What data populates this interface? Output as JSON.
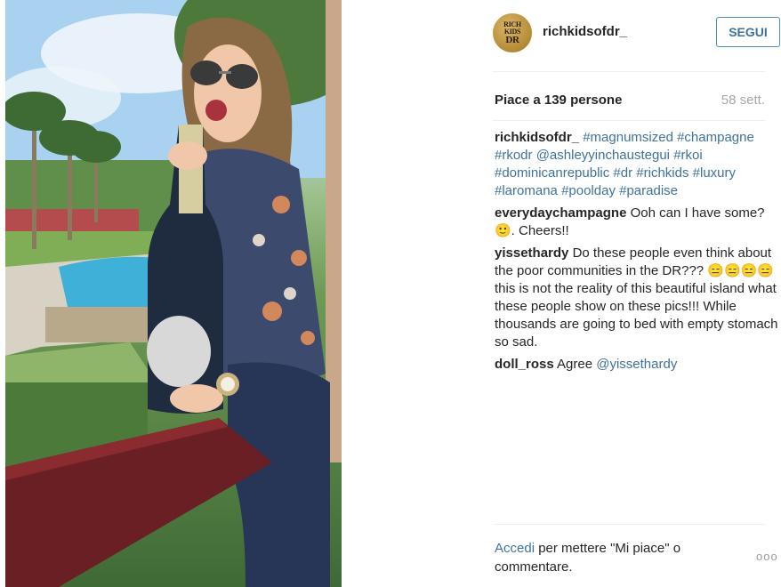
{
  "profile": {
    "username": "richkidsofdr_",
    "avatar_lines": [
      "RICH",
      "KIDS",
      "DR"
    ],
    "follow_label": "SEGUI"
  },
  "stats": {
    "likes_text": "Piace a 139 persone",
    "time_text": "58 sett."
  },
  "comments": [
    {
      "user": "richkidsofdr_",
      "parts": [
        {
          "text": "#magnumsized",
          "tag": true
        },
        {
          "text": " ",
          "tag": false
        },
        {
          "text": "#champagne",
          "tag": true
        },
        {
          "text": " ",
          "tag": false
        },
        {
          "text": "#rkodr",
          "tag": true
        },
        {
          "text": " ",
          "tag": false
        },
        {
          "text": "@ashleyyinchaustegui",
          "tag": true
        },
        {
          "text": " ",
          "tag": false
        },
        {
          "text": "#rkoi",
          "tag": true
        },
        {
          "text": " ",
          "tag": false
        },
        {
          "text": "#dominicanrepublic",
          "tag": true
        },
        {
          "text": " ",
          "tag": false
        },
        {
          "text": "#dr",
          "tag": true
        },
        {
          "text": " ",
          "tag": false
        },
        {
          "text": "#richkids",
          "tag": true
        },
        {
          "text": " ",
          "tag": false
        },
        {
          "text": "#luxury",
          "tag": true
        },
        {
          "text": " ",
          "tag": false
        },
        {
          "text": "#laromana",
          "tag": true
        },
        {
          "text": " ",
          "tag": false
        },
        {
          "text": "#poolday",
          "tag": true
        },
        {
          "text": " ",
          "tag": false
        },
        {
          "text": "#paradise",
          "tag": true
        }
      ]
    },
    {
      "user": "everydaychampagne",
      "parts": [
        {
          "text": "Ooh can I have some? 🙂. Cheers!!",
          "tag": false
        }
      ]
    },
    {
      "user": "yissethardy",
      "parts": [
        {
          "text": "Do these people even think about the poor communities in the DR??? 😑😑😑😑 this is not the reality of this beautiful island what these people show on these pics!!! While thousands are going to bed with empty stomach so sad.",
          "tag": false
        }
      ]
    },
    {
      "user": "doll_ross",
      "parts": [
        {
          "text": "Agree ",
          "tag": false
        },
        {
          "text": "@yissethardy",
          "tag": true
        }
      ]
    }
  ],
  "footer": {
    "login_link": "Accedi",
    "login_text": " per mettere \"Mi piace\" o commentare.",
    "more_label": "ooo"
  }
}
